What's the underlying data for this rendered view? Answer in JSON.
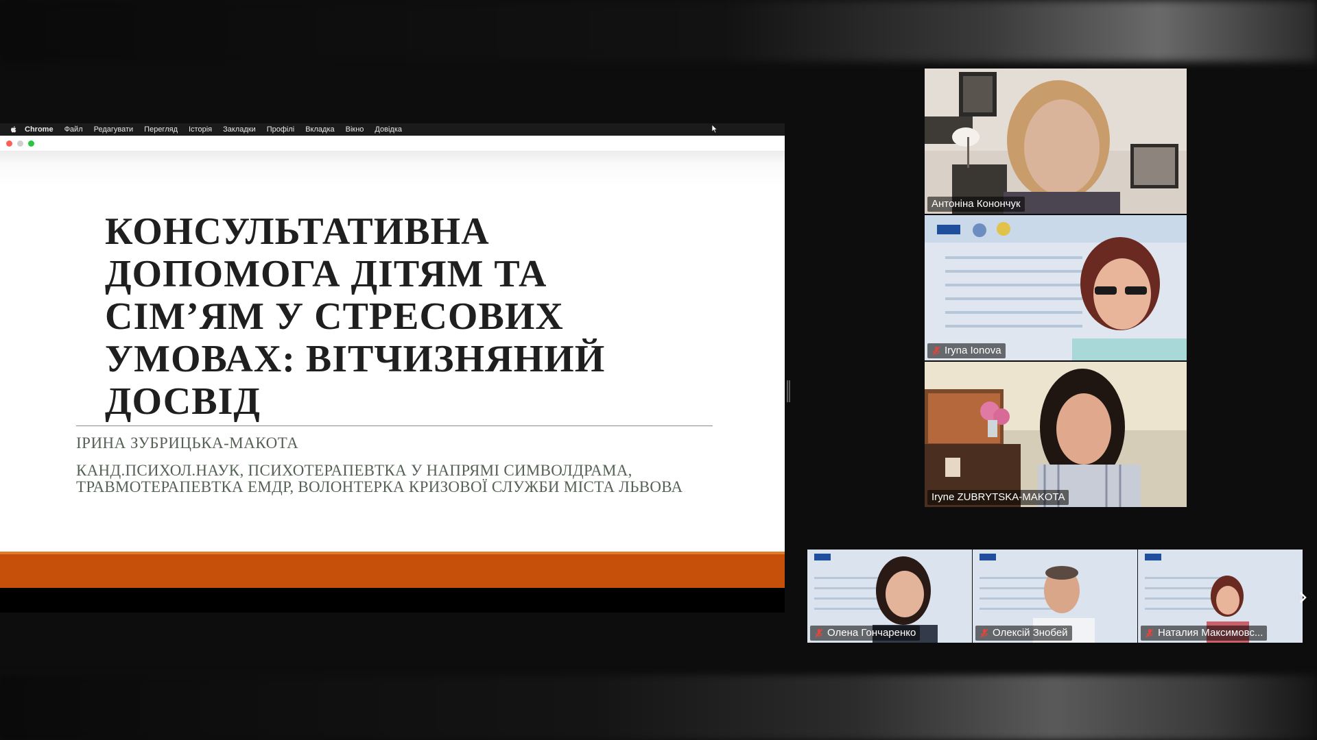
{
  "menubar": {
    "app_name": "Chrome",
    "items": [
      "Файл",
      "Редагувати",
      "Перегляд",
      "Історія",
      "Закладки",
      "Профілі",
      "Вкладка",
      "Вікно",
      "Довідка"
    ]
  },
  "slide": {
    "title": "КОНСУЛЬТАТИВНА\nДОПОМОГА ДІТЯМ ТА\nСІМ’ЯМ У СТРЕСОВИХ\nУМОВАХ: ВІТЧИЗНЯНИЙ\nДОСВІД",
    "author": "ІРИНА ЗУБРИЦЬКА-МАКОТА",
    "description": "КАНД.ПСИХОЛ.НАУК, ПСИХОТЕРАПЕВТКА У НАПРЯМІ СИМВОЛДРАМА, ТРАВМОТЕРАПЕВТКА ЕМДР, ВОЛОНТЕРКА КРИЗОВОЇ СЛУЖБИ МІСТА ЛЬВОВА",
    "colors": {
      "band": "#c6500a",
      "title": "#1f1f1f",
      "subtitle": "#556155"
    }
  },
  "participants": {
    "side": [
      {
        "name": "Антоніна Конончук",
        "muted": false,
        "active": false
      },
      {
        "name": "Iryna Ionova",
        "muted": true,
        "active": false
      },
      {
        "name": "Iryne ZUBRYTSKA-MAKOTA",
        "muted": false,
        "active": true
      }
    ],
    "strip": [
      {
        "name": "Олена Гончаренко",
        "muted": true
      },
      {
        "name": "Олексій Знобей",
        "muted": true
      },
      {
        "name": "Наталия Максимовс...",
        "muted": true
      }
    ]
  },
  "colors": {
    "active_speaker": "#2ed76a",
    "mute_icon": "#e0463b"
  }
}
